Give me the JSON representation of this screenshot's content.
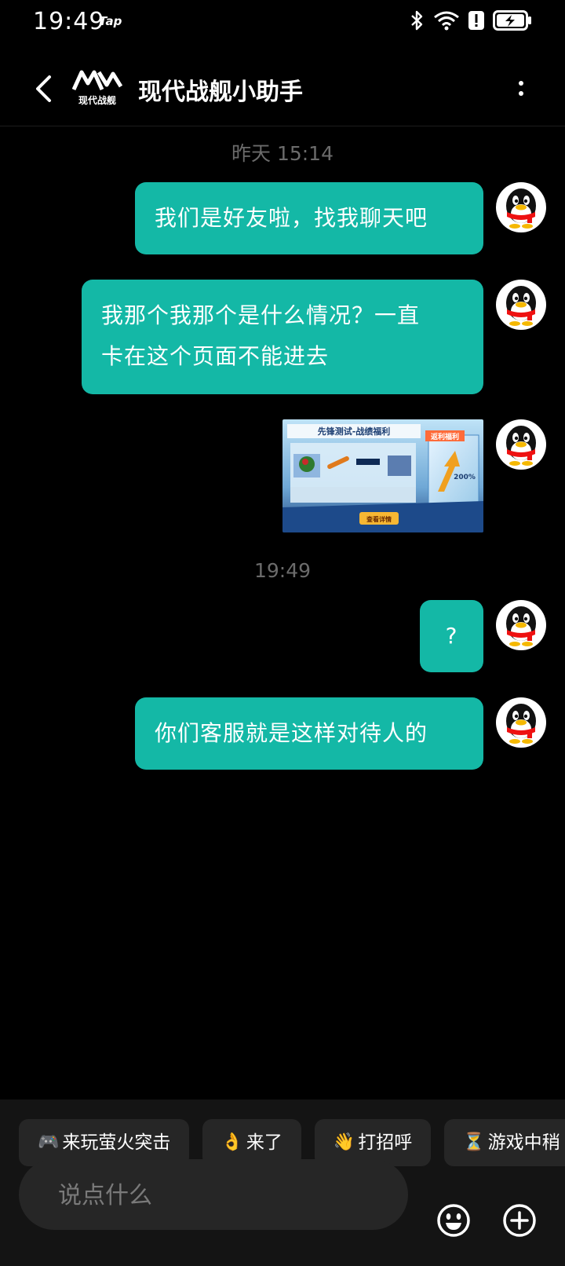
{
  "status_bar": {
    "time": "19:49",
    "app_label": "Tap"
  },
  "header": {
    "logo_text": "现代战舰",
    "title": "现代战舰小助手"
  },
  "messages": {
    "ts1": "昨天  15:14",
    "m1": "我们是好友啦，找我聊天吧",
    "m2_line1": "我那个我那个是什么情况？一直",
    "m2_line2": "卡在这个页面不能进去",
    "image_title": "先锋测试-战绩福利",
    "image_badge": "返利福利",
    "image_pct": "200%",
    "image_btn": "查看详情",
    "ts2": "19:49",
    "m3": "?",
    "m4": "你们客服就是这样对待人的"
  },
  "quick_replies": [
    {
      "emoji": "🎮",
      "label": "来玩萤火突击"
    },
    {
      "emoji": "👌",
      "label": "来了"
    },
    {
      "emoji": "👋",
      "label": "打招呼"
    },
    {
      "emoji": "⏳",
      "label": "游戏中稍"
    }
  ],
  "input": {
    "placeholder": "说点什么"
  },
  "colors": {
    "bubble": "#14b8a6",
    "background": "#000000",
    "panel": "#141414"
  }
}
